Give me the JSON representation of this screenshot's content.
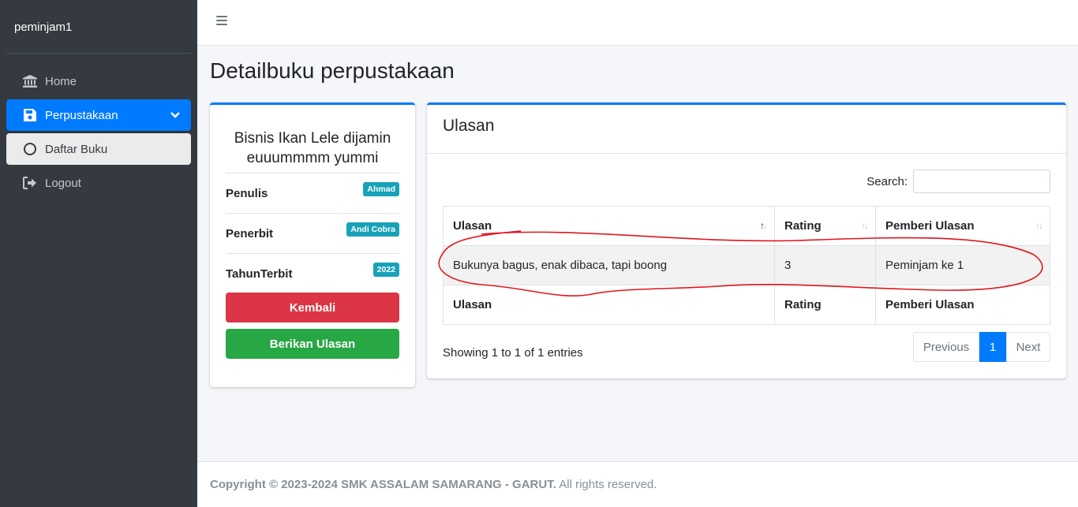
{
  "sidebar": {
    "brand": "peminjam1",
    "items": [
      {
        "label": "Home"
      },
      {
        "label": "Perpustakaan"
      },
      {
        "label": "Daftar Buku"
      },
      {
        "label": "Logout"
      }
    ]
  },
  "page": {
    "title": "Detailbuku perpustakaan"
  },
  "book": {
    "title": "Bisnis Ikan Lele dijamin euuummmm yummi",
    "info": [
      {
        "label": "Penulis",
        "value": "Ahmad"
      },
      {
        "label": "Penerbit",
        "value": "Andi Cobra"
      },
      {
        "label": "TahunTerbit",
        "value": "2022"
      }
    ],
    "back_label": "Kembali",
    "review_label": "Berikan Ulasan"
  },
  "reviews": {
    "header": "Ulasan",
    "search_label": "Search:",
    "columns": [
      "Ulasan",
      "Rating",
      "Pemberi Ulasan"
    ],
    "rows": [
      [
        "Bukunya bagus, enak dibaca, tapi boong",
        "3",
        "Peminjam ke 1"
      ]
    ],
    "info": "Showing 1 to 1 of 1 entries",
    "pager": {
      "prev": "Previous",
      "current": "1",
      "next": "Next"
    }
  },
  "footer": {
    "bold": "Copyright © 2023-2024 SMK ASSALAM SAMARANG - GARUT.",
    "rest": " All rights reserved."
  },
  "colors": {
    "primary": "#007bff",
    "danger": "#dc3545",
    "success": "#28a745",
    "info": "#17a2b8",
    "sidebar": "#343a40",
    "annotation": "#e0161b"
  }
}
